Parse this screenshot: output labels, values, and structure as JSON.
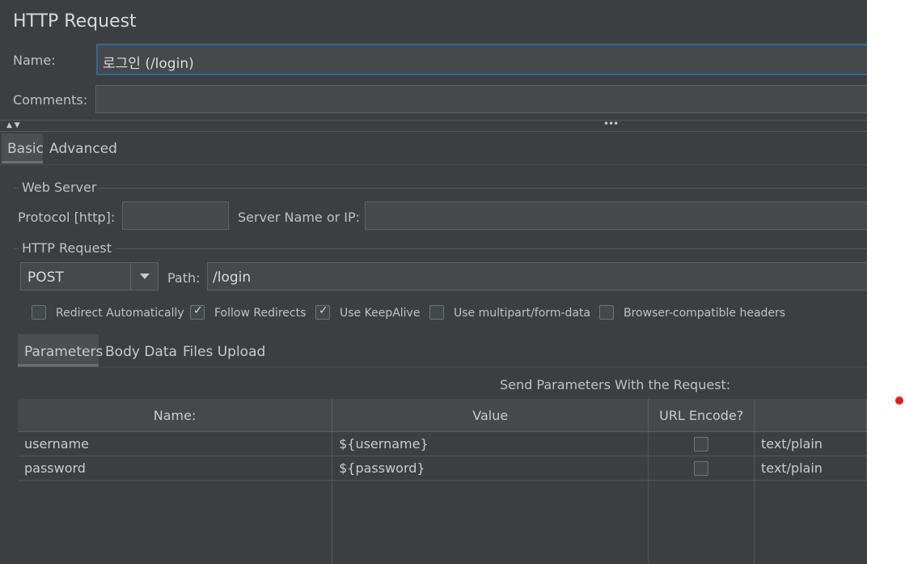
{
  "panel": {
    "title": "HTTP Request"
  },
  "name_field": {
    "label": "Name:",
    "value": "로그인 (/login)"
  },
  "comments_field": {
    "label": "Comments:",
    "value": ""
  },
  "splitter": {
    "dots": "•••"
  },
  "tabs": [
    {
      "label": "Basic",
      "active": true
    },
    {
      "label": "Advanced",
      "active": false
    }
  ],
  "web_server": {
    "legend": "Web Server",
    "protocol_label": "Protocol [http]:",
    "protocol_value": "",
    "server_label": "Server Name or IP:",
    "server_value": ""
  },
  "http_request": {
    "legend": "HTTP Request",
    "method": "POST",
    "path_label": "Path:",
    "path_value": "/login"
  },
  "options": [
    {
      "label": "Redirect Automatically",
      "checked": false
    },
    {
      "label": "Follow Redirects",
      "checked": true
    },
    {
      "label": "Use KeepAlive",
      "checked": true
    },
    {
      "label": "Use multipart/form-data",
      "checked": false
    },
    {
      "label": "Browser-compatible headers",
      "checked": false
    }
  ],
  "sub_tabs": [
    {
      "label": "Parameters",
      "active": true
    },
    {
      "label": "Body Data",
      "active": false
    },
    {
      "label": "Files Upload",
      "active": false
    }
  ],
  "params": {
    "caption": "Send Parameters With the Request:",
    "headers": [
      "Name:",
      "Value",
      "URL Encode?",
      ""
    ],
    "rows": [
      {
        "name": "username",
        "value": "${username}",
        "url_encode": false,
        "content_type": "text/plain"
      },
      {
        "name": "password",
        "value": "${password}",
        "url_encode": false,
        "content_type": "text/plain"
      }
    ]
  },
  "colors": {
    "background": "#3c3f41",
    "focus_border": "#3f6590",
    "red_dot": "#e01e1e"
  }
}
